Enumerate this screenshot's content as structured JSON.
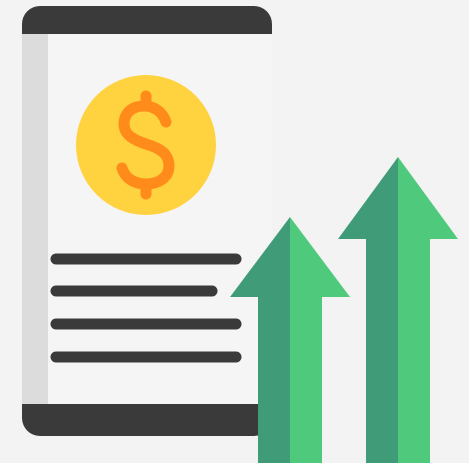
{
  "illustration": {
    "subject": "",
    "currency_symbol": "$",
    "colors": {
      "background": "#f3f3f3",
      "phone_frame": "#3a3a3a",
      "phone_screen": "#f5f5f5",
      "phone_side_strip": "#dcdcdc",
      "coin_fill": "#ffd23f",
      "coin_symbol": "#ff8c1a",
      "text_lines": "#3a3a3a",
      "arrow_light": "#4fc97b",
      "arrow_dark": "#3f9b78"
    },
    "icons": {
      "device": "smartphone-icon",
      "coin": "dollar-coin-icon",
      "growth": "up-arrows-icon"
    },
    "text_line_count": 4,
    "arrow_count": 2
  }
}
